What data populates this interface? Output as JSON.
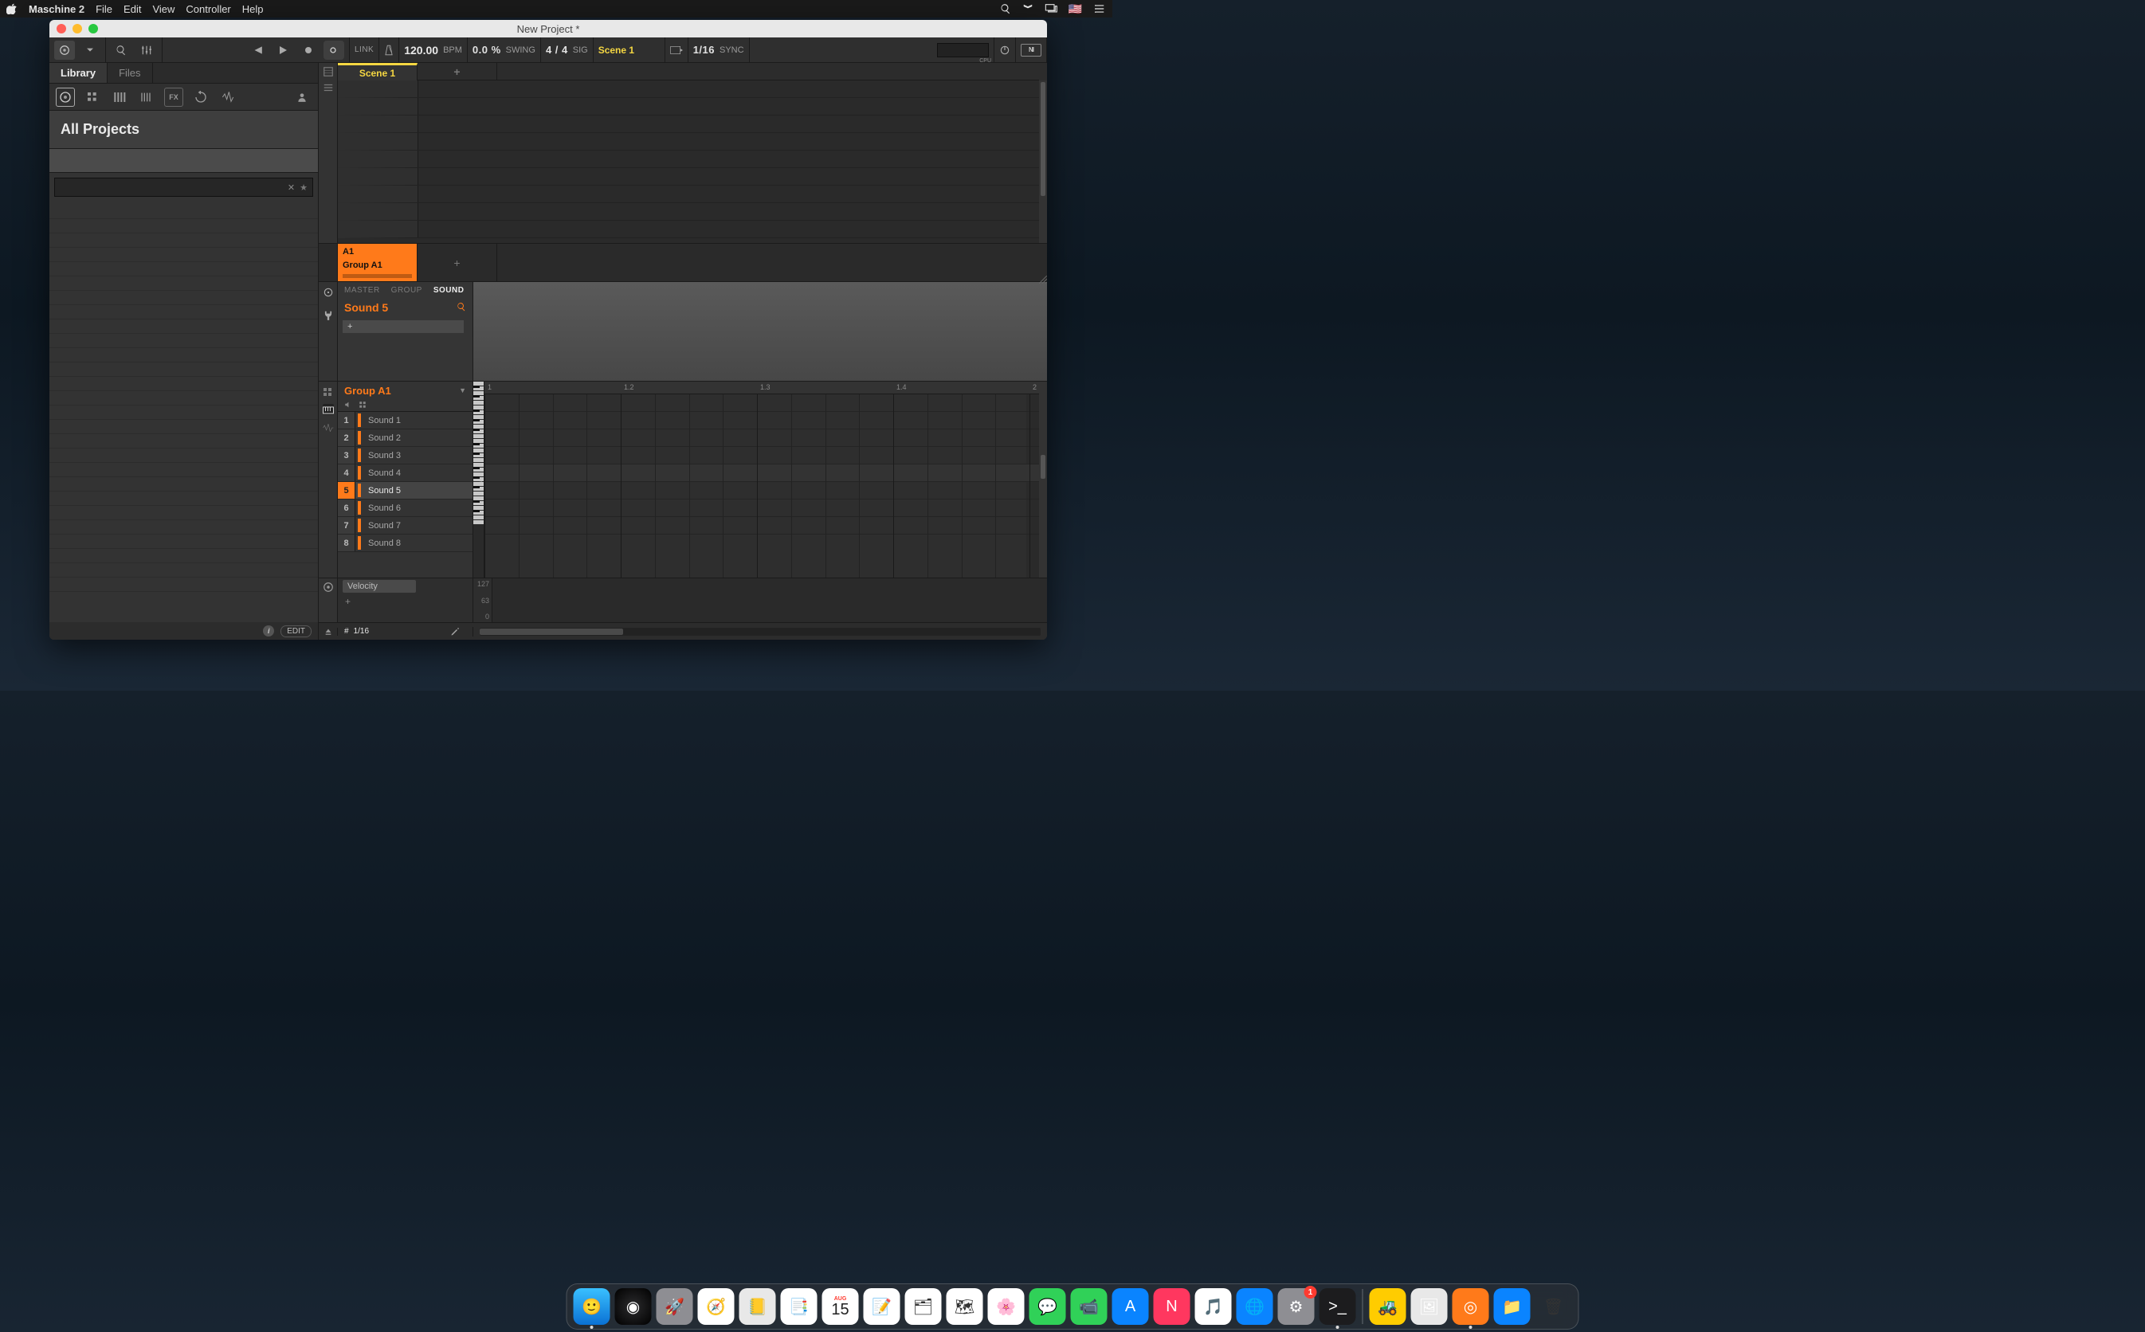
{
  "menubar": {
    "app": "Maschine 2",
    "items": [
      "File",
      "Edit",
      "View",
      "Controller",
      "Help"
    ]
  },
  "window": {
    "title": "New Project *"
  },
  "toolbar": {
    "link": "LINK",
    "bpm_value": "120.00",
    "bpm_label": "BPM",
    "swing_value": "0.0 %",
    "swing_label": "SWING",
    "sig_value": "4 / 4",
    "sig_label": "SIG",
    "scene": "Scene 1",
    "quant_value": "1/16",
    "sync_label": "SYNC",
    "cpu_label": "CPU"
  },
  "browser": {
    "tabs": {
      "library": "Library",
      "files": "Files"
    },
    "title": "All Projects",
    "footer_edit": "EDIT"
  },
  "arranger": {
    "scene_name": "Scene 1",
    "group_code": "A1",
    "group_name": "Group A1"
  },
  "soundpanel": {
    "tabs": {
      "master": "MASTER",
      "group": "GROUP",
      "sound": "SOUND"
    },
    "current_sound": "Sound 5",
    "add": "+"
  },
  "pattern": {
    "group": "Group A1",
    "sounds": [
      {
        "n": "1",
        "name": "Sound 1"
      },
      {
        "n": "2",
        "name": "Sound 2"
      },
      {
        "n": "3",
        "name": "Sound 3"
      },
      {
        "n": "4",
        "name": "Sound 4"
      },
      {
        "n": "5",
        "name": "Sound 5"
      },
      {
        "n": "6",
        "name": "Sound 6"
      },
      {
        "n": "7",
        "name": "Sound 7"
      },
      {
        "n": "8",
        "name": "Sound 8"
      }
    ],
    "selected_index": 4,
    "ruler": [
      "1",
      "1.2",
      "1.3",
      "1.4",
      "2"
    ],
    "key_range_low": "4",
    "key_range_high": "5"
  },
  "velocity": {
    "label": "Velocity",
    "max": "127",
    "mid": "63",
    "min": "0",
    "add": "+"
  },
  "bottombar": {
    "grid": "1/16"
  },
  "dock": {
    "apps": [
      {
        "id": "finder",
        "running": true,
        "bg": "linear-gradient(180deg,#3ac0ff,#0a71d4)",
        "glyph": "🙂"
      },
      {
        "id": "siri",
        "bg": "radial-gradient(circle,#2c2c2e,#000)",
        "glyph": "◉"
      },
      {
        "id": "launchpad",
        "bg": "#8e8e93",
        "glyph": "🚀"
      },
      {
        "id": "safari",
        "bg": "#fff",
        "glyph": "🧭"
      },
      {
        "id": "contacts",
        "bg": "#e8e8e8",
        "glyph": "📒"
      },
      {
        "id": "reminders",
        "bg": "#fff",
        "glyph": "📑"
      },
      {
        "id": "calendar",
        "bg": "#fff",
        "glyph": "15",
        "text": "AUG"
      },
      {
        "id": "notes",
        "bg": "#fff",
        "glyph": "📝"
      },
      {
        "id": "freeform",
        "bg": "#fff",
        "glyph": "🗂"
      },
      {
        "id": "maps",
        "bg": "#fff",
        "glyph": "🗺"
      },
      {
        "id": "photos",
        "bg": "#fff",
        "glyph": "🌸"
      },
      {
        "id": "messages",
        "bg": "#30d158",
        "glyph": "💬"
      },
      {
        "id": "facetime",
        "bg": "#30d158",
        "glyph": "📹"
      },
      {
        "id": "appstore",
        "bg": "#0a84ff",
        "glyph": "A"
      },
      {
        "id": "news",
        "bg": "#ff375f",
        "glyph": "N"
      },
      {
        "id": "itunes",
        "bg": "#fff",
        "glyph": "🎵"
      },
      {
        "id": "atlas",
        "bg": "#0a84ff",
        "glyph": "🌐"
      },
      {
        "id": "settings",
        "bg": "#8e8e93",
        "glyph": "⚙︎",
        "badge": "1"
      },
      {
        "id": "terminal",
        "bg": "#1c1c1e",
        "glyph": ">_",
        "running": true
      },
      {
        "id": "sep"
      },
      {
        "id": "forklift",
        "bg": "#ffcc00",
        "glyph": "🚜"
      },
      {
        "id": "image",
        "bg": "#e8e8e8",
        "glyph": "🖼"
      },
      {
        "id": "maschine",
        "bg": "#ff7a1a",
        "glyph": "◎",
        "running": true
      },
      {
        "id": "downloads",
        "bg": "#0a84ff",
        "glyph": "📁"
      },
      {
        "id": "trash",
        "bg": "transparent",
        "glyph": "🗑"
      }
    ]
  }
}
